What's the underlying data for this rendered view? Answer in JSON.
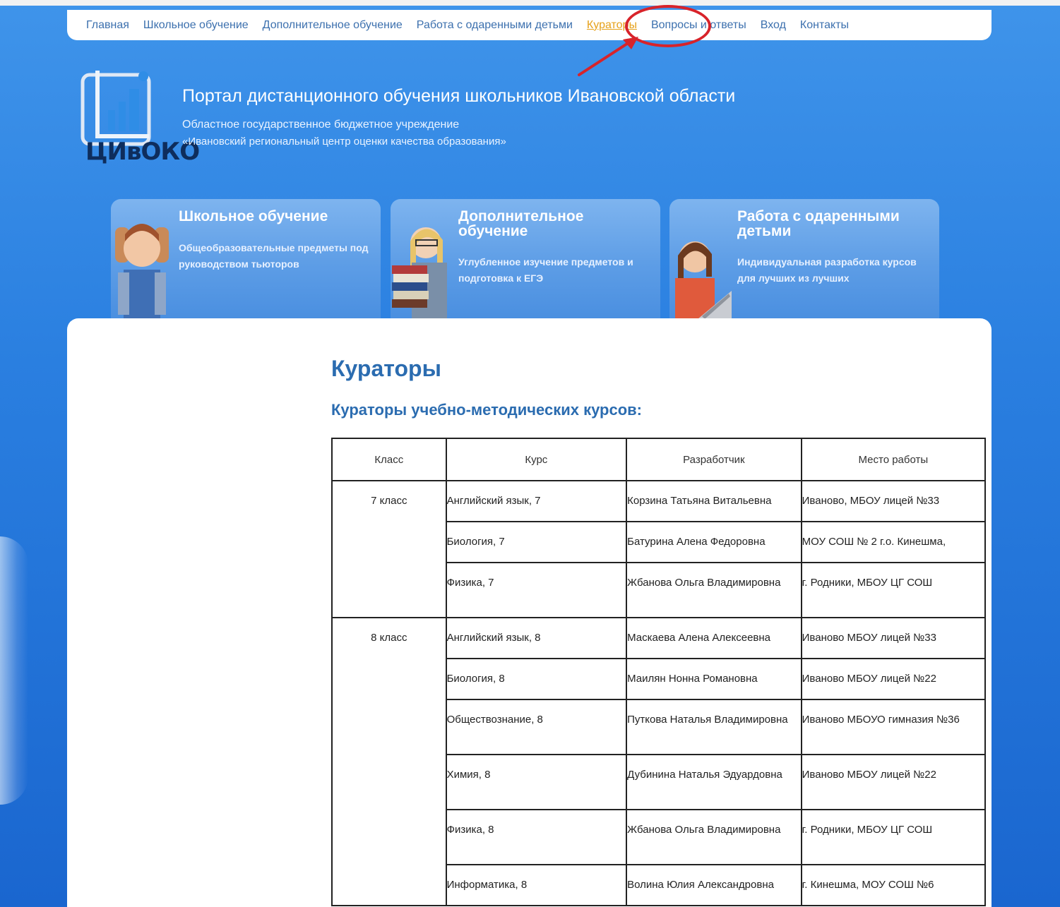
{
  "nav": {
    "items": [
      "Главная",
      "Школьное обучение",
      "Дополнительное обучение",
      "Работа с одаренными детьми",
      "Кураторы",
      "Вопросы и ответы",
      "Вход",
      "Контакты"
    ],
    "active_index": 4
  },
  "header": {
    "logo_text": "ЦИвОКО",
    "title": "Портал дистанционного обучения школьников Ивановской области",
    "subtitle_line1": "Областное государственное бюджетное учреждение",
    "subtitle_line2": "«Ивановский региональный центр оценки качества образования»"
  },
  "cards": [
    {
      "title": "Школьное обучение",
      "desc": "Общеобразовательные предметы под руководством тьюторов"
    },
    {
      "title": "Дополнительное обучение",
      "desc": "Углубленное изучение предметов и подготовка к ЕГЭ"
    },
    {
      "title": "Работа с одаренными детьми",
      "desc": "Индивидуальная разработка курсов для лучших из лучших"
    }
  ],
  "main": {
    "heading": "Кураторы",
    "subheading": "Кураторы учебно-методических курсов:",
    "table": {
      "headers": [
        "Класс",
        "Курс",
        "Разработчик",
        "Место работы"
      ],
      "groups": [
        {
          "class": "7 класс",
          "rows": [
            {
              "course": "Английский язык, 7",
              "developer": "Корзина Татьяна Витальевна",
              "place": "Иваново, МБОУ лицей №33"
            },
            {
              "course": "Биология, 7",
              "developer": "Батурина Алена Федоровна",
              "place": "МОУ СОШ № 2 г.о. Кинешма,"
            },
            {
              "course": "Физика, 7",
              "developer": "Жбанова Ольга Владимировна",
              "place": "г. Родники, МБОУ ЦГ СОШ"
            }
          ]
        },
        {
          "class": "8 класс",
          "rows": [
            {
              "course": "Английский язык, 8",
              "developer": "Маскаева Алена Алексеевна",
              "place": "Иваново МБОУ лицей №33"
            },
            {
              "course": "Биология, 8",
              "developer": "Маилян Нонна Романовна",
              "place": "Иваново МБОУ лицей №22"
            },
            {
              "course": "Обществознание, 8",
              "developer": "Путкова Наталья Владимировна",
              "place": "Иваново МБОУО гимназия №36"
            },
            {
              "course": "Химия, 8",
              "developer": "Дубинина Наталья Эдуардовна",
              "place": "Иваново МБОУ лицей №22"
            },
            {
              "course": "Физика, 8",
              "developer": "Жбанова Ольга Владимировна",
              "place": "г. Родники, МБОУ ЦГ СОШ"
            },
            {
              "course": "Информатика, 8",
              "developer": "Волина Юлия Александровна",
              "place": "г. Кинешма, МОУ СОШ №6"
            }
          ]
        }
      ]
    }
  },
  "colors": {
    "background": "#2a7fe0",
    "link": "#3c70ae",
    "active_link": "#e6a11a",
    "heading": "#2b6cb0",
    "highlight": "#d8232a"
  }
}
